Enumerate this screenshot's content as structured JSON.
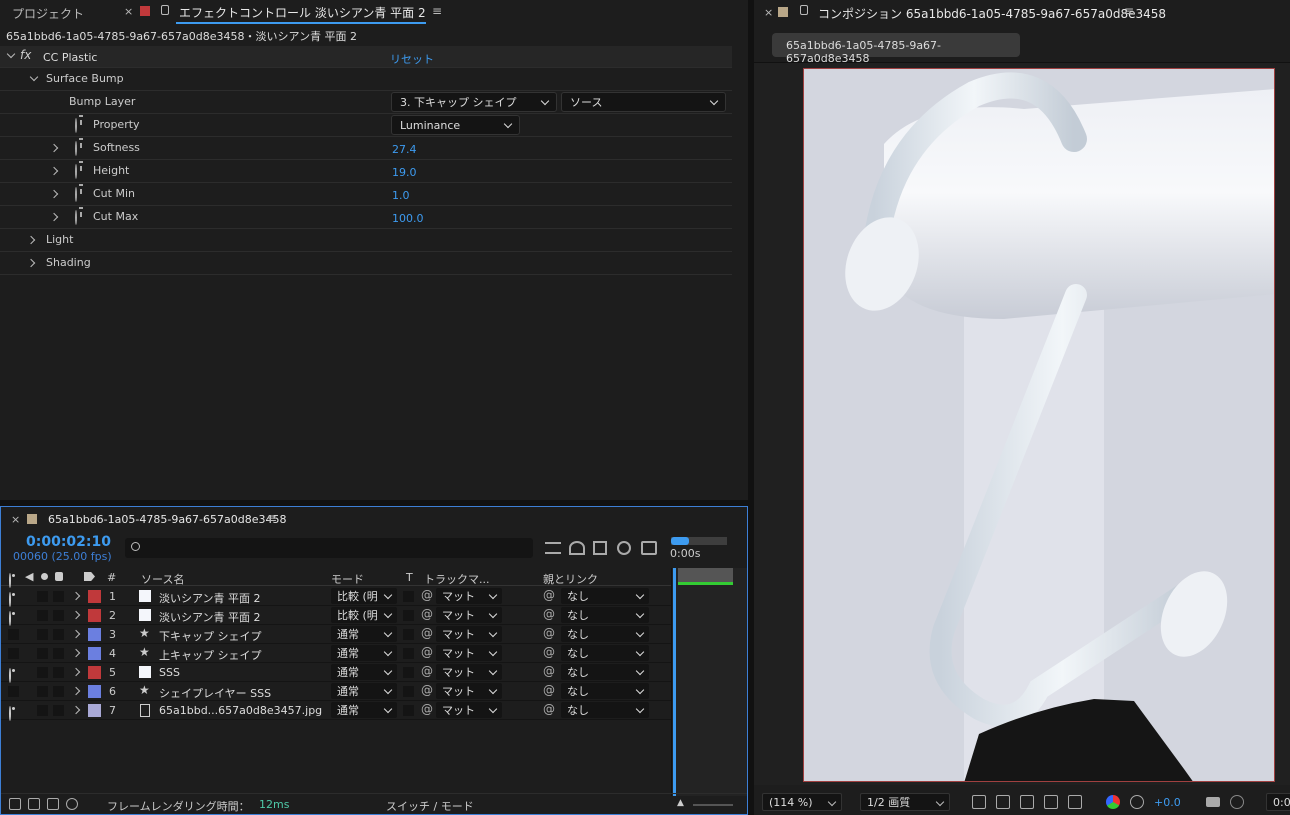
{
  "effect_panel": {
    "tab_project": "プロジェクト",
    "tab_effect": "エフェクトコントロール 淡いシアン青 平面 2",
    "subtitle": "65a1bbd6-1a05-4785-9a67-657a0d8e3458・淡いシアン青 平面 2",
    "effect_name": "CC Plastic",
    "reset": "リセット",
    "group_surface": "Surface Bump",
    "bump_layer_label": "Bump Layer",
    "bump_layer_value": "3. 下キャップ シェイプ",
    "bump_layer_source": "ソース",
    "property_label": "Property",
    "property_value": "Luminance",
    "params": [
      {
        "label": "Softness",
        "value": "27.4"
      },
      {
        "label": "Height",
        "value": "19.0"
      },
      {
        "label": "Cut Min",
        "value": "1.0"
      },
      {
        "label": "Cut Max",
        "value": "100.0"
      }
    ],
    "group_light": "Light",
    "group_shading": "Shading"
  },
  "composition_panel": {
    "tab_title": "コンポジション 65a1bbd6-1a05-4785-9a67-657a0d8e3458",
    "comp_tab": "65a1bbd6-1a05-4785-9a67-657a0d8e3458",
    "zoom": "(114 %)",
    "quality": "1/2 画質",
    "exposure": "+0.0",
    "time_short": "0:0"
  },
  "timeline": {
    "tab_title": "65a1bbd6-1a05-4785-9a67-657a0d8e3458",
    "timecode": "0:00:02:10",
    "frames": "00060 (25.00 fps)",
    "ruler_label": "0:00s",
    "columns": {
      "num": "#",
      "source": "ソース名",
      "mode": "モード",
      "t": "T",
      "track": "トラックマ...",
      "parent": "親とリンク"
    },
    "layers": [
      {
        "num": "1",
        "name": "淡いシアン青 平面 2",
        "type": "solid",
        "mode": "比較 (明",
        "matte": "マット",
        "parent": "なし",
        "label": "#c0393b",
        "bar": "#8c3b3d",
        "visible": true
      },
      {
        "num": "2",
        "name": "淡いシアン青 平面 2",
        "type": "solid",
        "mode": "比較 (明",
        "matte": "マット",
        "parent": "なし",
        "label": "#c0393b",
        "bar": "#8c3b3d",
        "visible": true
      },
      {
        "num": "3",
        "name": "下キャップ シェイプ",
        "type": "shape",
        "mode": "通常",
        "matte": "マット",
        "parent": "なし",
        "label": "#6b7fe0",
        "bar": "#4d5a9b",
        "visible": false
      },
      {
        "num": "4",
        "name": "上キャップ シェイプ",
        "type": "shape",
        "mode": "通常",
        "matte": "マット",
        "parent": "なし",
        "label": "#6b7fe0",
        "bar": "#4d5a9b",
        "visible": false
      },
      {
        "num": "5",
        "name": "SSS",
        "type": "solid",
        "mode": "通常",
        "matte": "マット",
        "parent": "なし",
        "label": "#c0393b",
        "bar": "#8c3b3d",
        "visible": true
      },
      {
        "num": "6",
        "name": "シェイプレイヤー SSS",
        "type": "shape",
        "mode": "通常",
        "matte": "マット",
        "parent": "なし",
        "label": "#6b7fe0",
        "bar": "#4d5a9b",
        "visible": false
      },
      {
        "num": "7",
        "name": "65a1bbd...657a0d8e3457.jpg",
        "type": "footage",
        "mode": "通常",
        "matte": "マット",
        "parent": "なし",
        "label": "#a9a9d6",
        "bar": "#6b6b80",
        "visible": true
      }
    ],
    "footer_render_label": "フレームレンダリング時間：",
    "footer_render_value": "12ms",
    "footer_switch": "スイッチ / モード"
  }
}
